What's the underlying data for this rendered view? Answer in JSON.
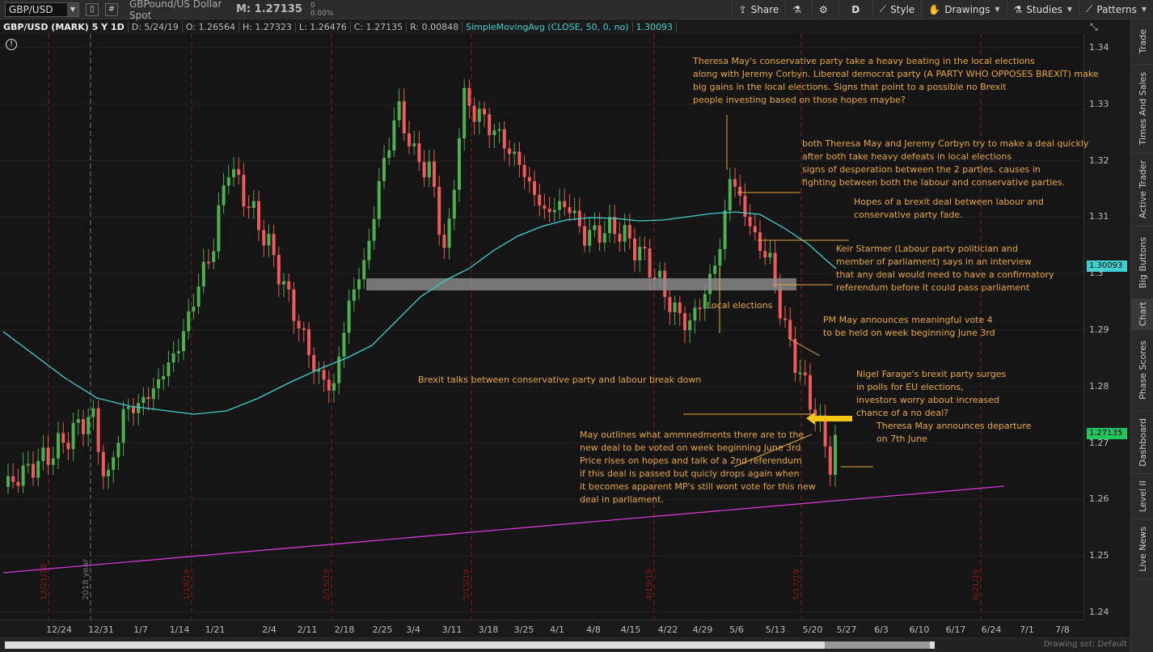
{
  "toolbar": {
    "symbol": "GBP/USD",
    "description": "GBPound/US Dollar Spot",
    "mark": "M: 1.27135",
    "change_value": "0",
    "change_pct": "0.00%",
    "share": "Share",
    "period": "D",
    "style": "Style",
    "drawings": "Drawings",
    "studies": "Studies",
    "patterns": "Patterns"
  },
  "infobar": {
    "title": "GBP/USD (MARK) 5 Y 1D",
    "d": "D: 5/24/19",
    "o": "O: 1.26564",
    "h": "H: 1.27323",
    "l": "L: 1.26476",
    "c": "C: 1.27135",
    "r": "R: 0.00848",
    "sma": "SimpleMovingAvg (CLOSE, 50, 0, no)",
    "sma_value": "1.30093"
  },
  "price_axis": {
    "labels": [
      "1.34",
      "1.33",
      "1.32",
      "1.31",
      "1.3",
      "1.29",
      "1.28",
      "1.27",
      "1.26",
      "1.25",
      "1.24"
    ],
    "sma_tag": "1.30093",
    "last_tag": "1.27135",
    "sma_color": "#3fd1d1",
    "last_color": "#22c55e"
  },
  "date_axis": {
    "labels": [
      "12/24",
      "12/31",
      "1/7",
      "1/14",
      "1/21",
      "2/4",
      "2/11",
      "2/18",
      "2/25",
      "3/4",
      "3/11",
      "3/18",
      "3/25",
      "4/1",
      "4/8",
      "4/15",
      "4/22",
      "4/29",
      "5/6",
      "5/13",
      "5/20",
      "5/27",
      "6/3",
      "6/10",
      "6/17",
      "6/24",
      "7/1",
      "7/8"
    ]
  },
  "vertical_markers": [
    "12/21/18",
    "2018 year",
    "1/18/19",
    "2/15/19",
    "3/15/19",
    "4/19/19",
    "5/17/19",
    "6/21/19"
  ],
  "annotations": {
    "a1": [
      "Theresa May's conservative party take a heavy beating in the local elections",
      "along with Jeremy Corbyn. Libereal democrat party (A PARTY WHO OPPOSES BREXIT) make",
      "big gains in the local elections. Signs that point to a possible no Brexit",
      "people investing based on those hopes maybe?"
    ],
    "a2": [
      "both Theresa May and Jeremy Corbyn try to make a deal quickly",
      "after both take heavy defeats in local elections",
      "signs of desperation between the 2 parties. causes in",
      "fighting between both the labour and conservative parties."
    ],
    "a3": [
      "Hopes of a brexit deal between labour and",
      "conservative party fade."
    ],
    "a4": [
      "Keir Starmer (Labour party politician and",
      "member of parliament) says in an interview",
      "that any deal would need to have a confirmatory",
      "referendum before it could pass parliament"
    ],
    "a5": [
      "Local elections"
    ],
    "a6": [
      "PM May announces meaningful vote 4",
      "to be held on week beginning June 3rd"
    ],
    "a7": [
      "Brexit talks between conservative party and labour break down"
    ],
    "a8": [
      "Nigel Farage's brexit party surges",
      "in polls for EU elections,",
      "investors worry about increased",
      "chance of a no deal?"
    ],
    "a9": [
      "Theresa May announces departure",
      "on 7th June"
    ],
    "a10": [
      "May outlines what ammnedments there are to the",
      "new deal to be voted on week beginning June 3rd",
      "Price rises on hopes and talk of a 2nd referendum",
      "if this deal is passed but quicly drops again when",
      "it becomes apparent MP's still wont vote for this new",
      "deal in parliament."
    ]
  },
  "side_tabs": [
    "Trade",
    "Times And Sales",
    "Active Trader",
    "Big Buttons",
    "Chart",
    "Phase Scores",
    "Dashboard",
    "Level II",
    "Live News"
  ],
  "bottom": {
    "drawing_set": "Drawing set: Default"
  }
}
